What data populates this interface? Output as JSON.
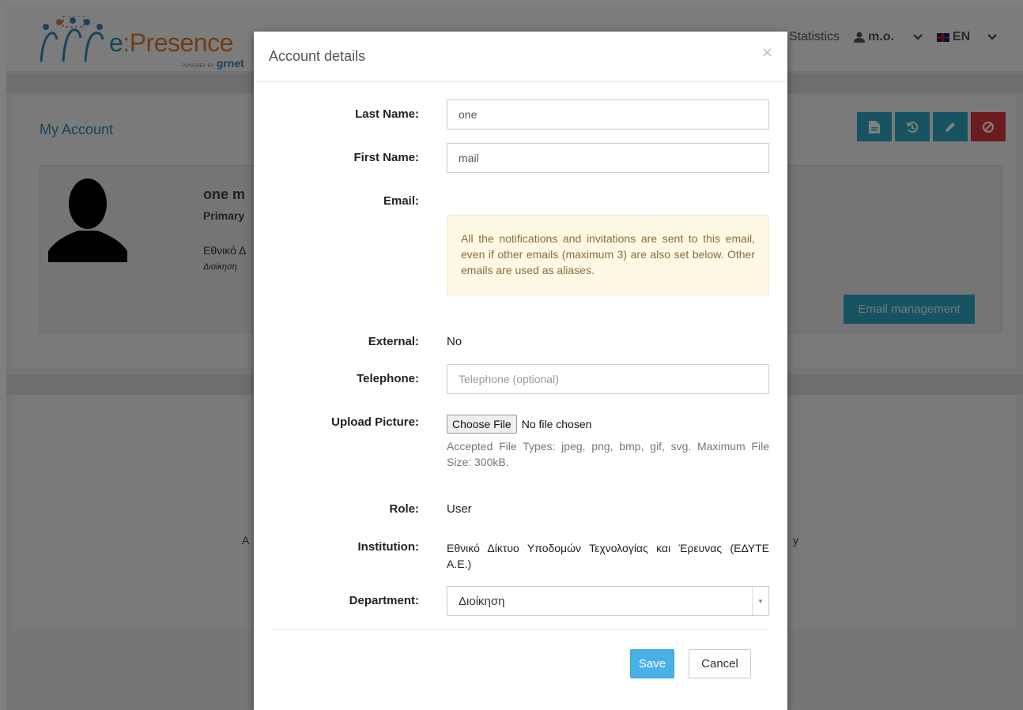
{
  "background": {
    "logo": {
      "brand_prefix": "e",
      "brand_rest": ":Presence",
      "powered_by": "POWERED BY",
      "sub": "grnet"
    },
    "nav": {
      "statistics": "Statistics",
      "user": "m.o.",
      "lang": "EN"
    },
    "page_title": "My Account",
    "profile": {
      "name": "one m",
      "primary": "Primary",
      "institution": "Εθνικό Δ",
      "department": "Διοίκηση"
    },
    "email_management_label": "Email management",
    "lower_fragment_left": "A",
    "lower_fragment_right": "y"
  },
  "modal": {
    "title": "Account details",
    "close_label": "×",
    "fields": {
      "last_name": {
        "label": "Last Name:",
        "value": "one"
      },
      "first_name": {
        "label": "First Name:",
        "value": "mail"
      },
      "email": {
        "label": "Email:",
        "note": "All the notifications and invitations are sent to this email, even if other emails (maximum 3) are also set below. Other emails are used as aliases."
      },
      "external": {
        "label": "External:",
        "value": "No"
      },
      "telephone": {
        "label": "Telephone:",
        "placeholder": "Telephone (optional)"
      },
      "upload": {
        "label": "Upload Picture:",
        "button": "Choose File",
        "status": "No file chosen",
        "help": "Accepted File Types: jpeg, png, bmp, gif, svg. Maximum File Size: 300kB."
      },
      "role": {
        "label": "Role:",
        "value": "User"
      },
      "institution": {
        "label": "Institution:",
        "value": "Εθνικό Δίκτυο Υποδομών Τεχνολογίας και Έρευνας (ΕΔΥΤΕ Α.Ε.)"
      },
      "department": {
        "label": "Department:",
        "value": "Διοίκηση"
      }
    },
    "save_label": "Save",
    "cancel_label": "Cancel"
  },
  "colors": {
    "accent": "#2ea6c5",
    "danger": "#d9363e",
    "primary_button": "#4ab1e8",
    "link": "#2f88b8",
    "logo_orange": "#e07b2c"
  },
  "icons": [
    "people-logo-icon",
    "user-icon",
    "chevron-down-icon",
    "uk-flag-icon",
    "document-icon",
    "history-icon",
    "pencil-icon",
    "ban-icon",
    "avatar-silhouette-icon",
    "close-icon",
    "select-arrow-icon"
  ]
}
